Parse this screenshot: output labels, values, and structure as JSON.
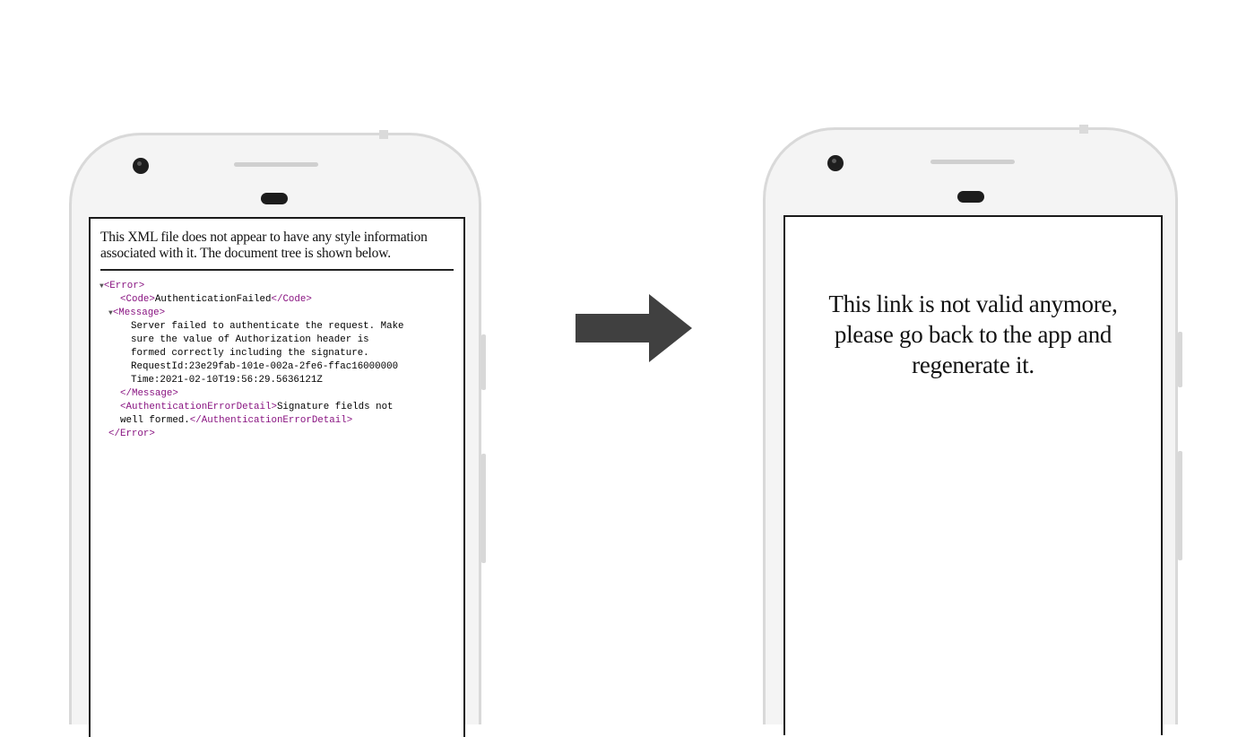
{
  "left_phone": {
    "notice": "This XML file does not appear to have any style information associated with it. The document tree is shown below.",
    "xml_lines": {
      "error_open": "<Error>",
      "code_open": "<Code>",
      "code_value": "AuthenticationFailed",
      "code_close": "</Code>",
      "message_open": "<Message>",
      "message_text_1": "Server failed to authenticate the request. Make",
      "message_text_2": "sure the value of Authorization header is",
      "message_text_3": "formed correctly including the signature.",
      "message_text_4": "RequestId:23e29fab-101e-002a-2fe6-ffac16000000",
      "message_text_5": "Time:2021-02-10T19:56:29.5636121Z",
      "message_close": "</Message>",
      "detail_open": "<AuthenticationErrorDetail>",
      "detail_value_1": "Signature fields not",
      "detail_value_2": "well formed.",
      "detail_close": "</AuthenticationErrorDetail>",
      "error_close": "</Error>"
    }
  },
  "right_phone": {
    "message": "This link is not valid anymore,\nplease go back to the app and\nregenerate it."
  },
  "icons": {
    "arrow": "arrow-right-icon",
    "expand": "triangle-down-icon"
  },
  "colors": {
    "xml_tag": "#881280",
    "arrow": "#404040",
    "phone_body": "#f4f4f4"
  }
}
